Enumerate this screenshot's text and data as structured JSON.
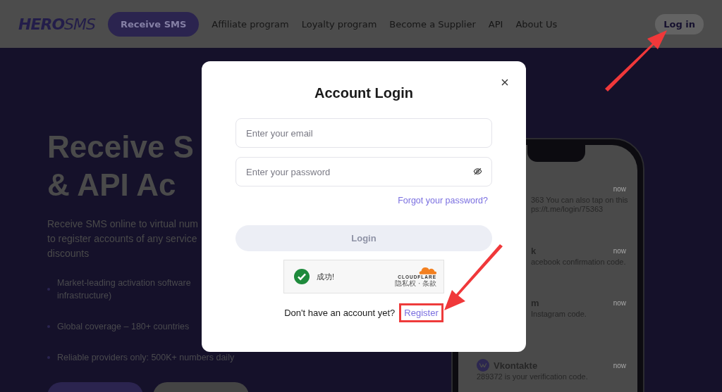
{
  "header": {
    "logo": {
      "bold": "HERO",
      "light": "SMS"
    },
    "nav": [
      {
        "label": "Receive SMS",
        "kind": "pill"
      },
      {
        "label": "Affiliate program",
        "kind": "link"
      },
      {
        "label": "Loyalty program",
        "kind": "link"
      },
      {
        "label": "Become a Supplier",
        "kind": "link"
      },
      {
        "label": "API",
        "kind": "link"
      },
      {
        "label": "About Us",
        "kind": "link"
      }
    ],
    "login_button": "Log in"
  },
  "hero": {
    "title_lines": [
      "Receive S",
      "& API Ac"
    ],
    "description_lines": [
      "Receive SMS online to virtual num",
      "to register accounts of any service",
      "discounts"
    ],
    "bullets": [
      [
        "Market-leading activation software",
        "infrastructure)"
      ],
      [
        "Global coverage – 180+ countries"
      ],
      [
        "Reliable providers only: 500K+ numbers daily"
      ]
    ]
  },
  "phone": {
    "messages": [
      {
        "time": "now",
        "body": [
          "363 You can also tap on this",
          "ps://t.me/login/75363"
        ]
      },
      {
        "title": "k",
        "time": "now",
        "body": [
          "acebook confirmation code."
        ]
      },
      {
        "title": "m",
        "time": "now",
        "body": [
          "Instagram code."
        ]
      },
      {
        "title": "Vkontakte",
        "time": "now",
        "icon": true,
        "body": [
          "289372 is your verification code."
        ]
      }
    ]
  },
  "modal": {
    "title": "Account Login",
    "fields": [
      {
        "kind": "email",
        "placeholder": "Enter your email"
      },
      {
        "kind": "password",
        "placeholder": "Enter your password"
      }
    ],
    "forgot_link": "Forgot your password?",
    "login_button": {
      "label": "Login",
      "disabled": true
    },
    "captcha": {
      "status": "成功!",
      "success": true,
      "brand": "CLOUDFLARE",
      "links": "隐私权 · 条款"
    },
    "footer": {
      "prompt": "Don't have an account yet?",
      "link": "Register",
      "highlighted": true
    }
  }
}
